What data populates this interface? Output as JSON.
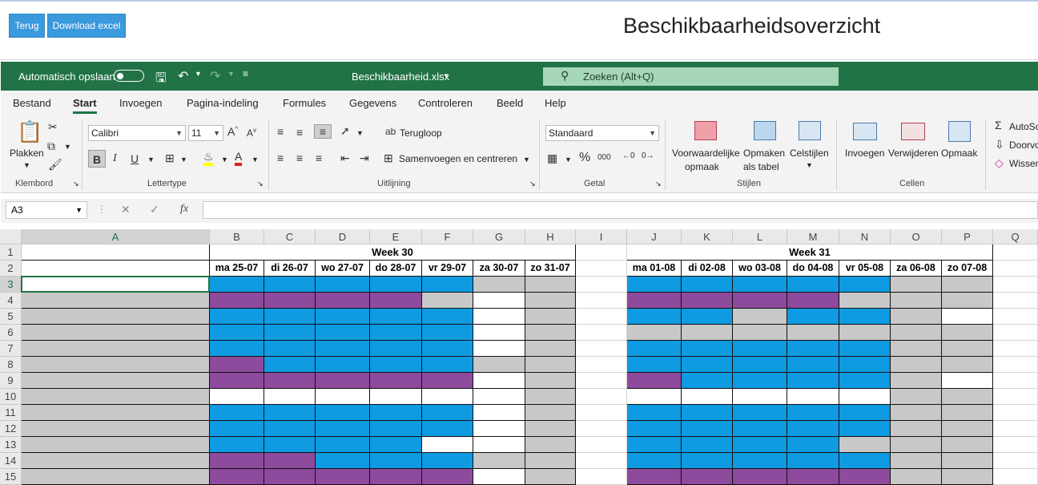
{
  "web": {
    "back_label": "Terug",
    "download_label": "Download excel",
    "page_title": "Beschikbaarheidsoverzicht"
  },
  "excel": {
    "autosave_label": "Automatisch opslaan",
    "filename": "Beschikbaarheid.xlsx",
    "search_placeholder": "Zoeken (Alt+Q)",
    "tabs": [
      "Bestand",
      "Start",
      "Invoegen",
      "Pagina-indeling",
      "Formules",
      "Gegevens",
      "Controleren",
      "Beeld",
      "Help"
    ],
    "active_tab": "Start",
    "ribbon": {
      "paste_label": "Plakken",
      "group_clipboard": "Klembord",
      "font_name": "Calibri",
      "font_size": "11",
      "group_font": "Lettertype",
      "wrap_label": "Terugloop",
      "merge_label": "Samenvoegen en centreren",
      "group_alignment": "Uitlijning",
      "number_format": "Standaard",
      "group_number": "Getal",
      "conditional_label_1": "Voorwaardelijke",
      "conditional_label_2": "opmaak",
      "format_table_label_1": "Opmaken",
      "format_table_label_2": "als tabel",
      "cellstyles_label": "Celstijlen",
      "group_styles": "Stijlen",
      "insert_label": "Invoegen",
      "delete_label": "Verwijderen",
      "format_label": "Opmaak",
      "group_cells": "Cellen",
      "autosum_label": "AutoSo",
      "fill_label": "Doorvo",
      "clear_label": "Wissen"
    },
    "name_box": "A3",
    "formula_fx": "fx",
    "columns": [
      "A",
      "B",
      "C",
      "D",
      "E",
      "F",
      "G",
      "H",
      "I",
      "J",
      "K",
      "L",
      "M",
      "N",
      "O",
      "P",
      "Q"
    ],
    "rows": [
      "1",
      "2",
      "3",
      "4",
      "5",
      "6",
      "7",
      "8",
      "9",
      "10",
      "11",
      "12",
      "13",
      "14",
      "15"
    ],
    "week1": {
      "title": "Week 30",
      "days": [
        "ma 25-07",
        "di 26-07",
        "wo 27-07",
        "do 28-07",
        "vr 29-07",
        "za 30-07",
        "zo 31-07"
      ]
    },
    "week2": {
      "title": "Week 31",
      "days": [
        "ma 01-08",
        "di 02-08",
        "wo 03-08",
        "do 04-08",
        "vr 05-08",
        "za 06-08",
        "zo 07-08"
      ]
    },
    "legend_colors": {
      "b": "#0e9be2",
      "p": "#8e4a9d",
      "g": "#c8c8c8",
      "w": "#ffffff"
    },
    "week1_cells": [
      [
        "b",
        "b",
        "b",
        "b",
        "b",
        "g",
        "g"
      ],
      [
        "p",
        "p",
        "p",
        "p",
        "g",
        "w",
        "g"
      ],
      [
        "b",
        "b",
        "b",
        "b",
        "b",
        "w",
        "g"
      ],
      [
        "b",
        "b",
        "b",
        "b",
        "b",
        "w",
        "g"
      ],
      [
        "b",
        "b",
        "b",
        "b",
        "b",
        "w",
        "g"
      ],
      [
        "p",
        "b",
        "b",
        "b",
        "b",
        "g",
        "g"
      ],
      [
        "p",
        "p",
        "p",
        "p",
        "p",
        "w",
        "g"
      ],
      [
        "w",
        "w",
        "w",
        "w",
        "w",
        "w",
        "g"
      ],
      [
        "b",
        "b",
        "b",
        "b",
        "b",
        "w",
        "g"
      ],
      [
        "b",
        "b",
        "b",
        "b",
        "b",
        "w",
        "g"
      ],
      [
        "b",
        "b",
        "b",
        "b",
        "w",
        "w",
        "g"
      ],
      [
        "p",
        "p",
        "b",
        "b",
        "b",
        "g",
        "g"
      ],
      [
        "p",
        "p",
        "p",
        "p",
        "p",
        "w",
        "g"
      ]
    ],
    "week2_cells": [
      [
        "b",
        "b",
        "b",
        "b",
        "b",
        "g",
        "g"
      ],
      [
        "p",
        "p",
        "p",
        "p",
        "g",
        "g",
        "g"
      ],
      [
        "b",
        "b",
        "g",
        "b",
        "b",
        "g",
        "w"
      ],
      [
        "g",
        "g",
        "g",
        "g",
        "g",
        "g",
        "g"
      ],
      [
        "b",
        "b",
        "b",
        "b",
        "b",
        "g",
        "g"
      ],
      [
        "b",
        "b",
        "b",
        "b",
        "b",
        "g",
        "g"
      ],
      [
        "p",
        "b",
        "b",
        "b",
        "b",
        "g",
        "w"
      ],
      [
        "w",
        "w",
        "w",
        "w",
        "w",
        "g",
        "g"
      ],
      [
        "b",
        "b",
        "b",
        "b",
        "b",
        "g",
        "g"
      ],
      [
        "b",
        "b",
        "b",
        "b",
        "b",
        "g",
        "g"
      ],
      [
        "b",
        "b",
        "b",
        "b",
        "g",
        "g",
        "g"
      ],
      [
        "b",
        "b",
        "b",
        "b",
        "b",
        "g",
        "g"
      ],
      [
        "p",
        "p",
        "p",
        "p",
        "p",
        "g",
        "g"
      ]
    ],
    "column_a_fill": [
      "w",
      "g",
      "g",
      "g",
      "g",
      "g",
      "g",
      "g",
      "g",
      "g",
      "g",
      "g",
      "g"
    ]
  }
}
